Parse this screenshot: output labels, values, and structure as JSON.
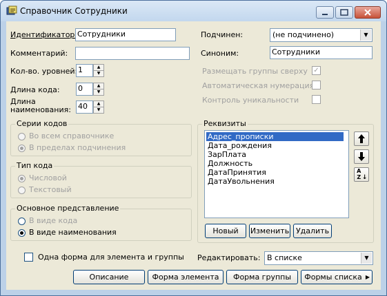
{
  "window": {
    "title": "Справочник Сотрудники"
  },
  "form": {
    "id_label": "Идентификатор:",
    "id_value": "Сотрудники",
    "comment_label": "Комментарий:",
    "comment_value": "",
    "levels_label": "Кол-во. уровней:",
    "levels_value": "1",
    "code_len_label": "Длина кода:",
    "code_len_value": "0",
    "name_len_label_1": "Длина",
    "name_len_label_2": "наименования:",
    "name_len_value": "40",
    "subordinate_label": "Подчинен:",
    "subordinate_value": "(не подчинено)",
    "synonym_label": "Синоним:",
    "synonym_value": "Сотрудники",
    "place_groups_label": "Размещать группы сверху",
    "place_groups_checked": true,
    "auto_num_label": "Автоматическая нумерация",
    "auto_num_checked": false,
    "uniq_label": "Контроль уникальности",
    "uniq_checked": false
  },
  "code_series": {
    "title": "Серии кодов",
    "options": [
      "Во всем справочнике",
      "В пределах подчинения"
    ],
    "selected": 1
  },
  "code_type": {
    "title": "Тип кода",
    "options": [
      "Числовой",
      "Текстовый"
    ],
    "selected": 0
  },
  "main_view": {
    "title": "Основное представление",
    "options": [
      "В виде кода",
      "В виде наименования"
    ],
    "selected": 1
  },
  "requisites": {
    "title": "Реквизиты",
    "items": [
      "Адрес_прописки",
      "Дата_рождения",
      "ЗарПлата",
      "Должность",
      "ДатаПринятия",
      "ДатаУвольнения"
    ],
    "selected": 0,
    "new_label": "Новый",
    "edit_label": "Изменить",
    "delete_label": "Удалить",
    "up_icon": "arrow-up",
    "down_icon": "arrow-down",
    "sort_icon": "sort-az",
    "sort_glyph": "AZ"
  },
  "bottom": {
    "one_form_label": "Одна форма для элемента и группы",
    "one_form_checked": false,
    "edit_mode_label": "Редактировать:",
    "edit_mode_value": "В списке",
    "buttons": [
      "Описание",
      "Форма элемента",
      "Форма группы",
      "Формы списка"
    ]
  },
  "colors": {
    "selection": "#316ac5",
    "client_bg": "#ece9d8"
  }
}
